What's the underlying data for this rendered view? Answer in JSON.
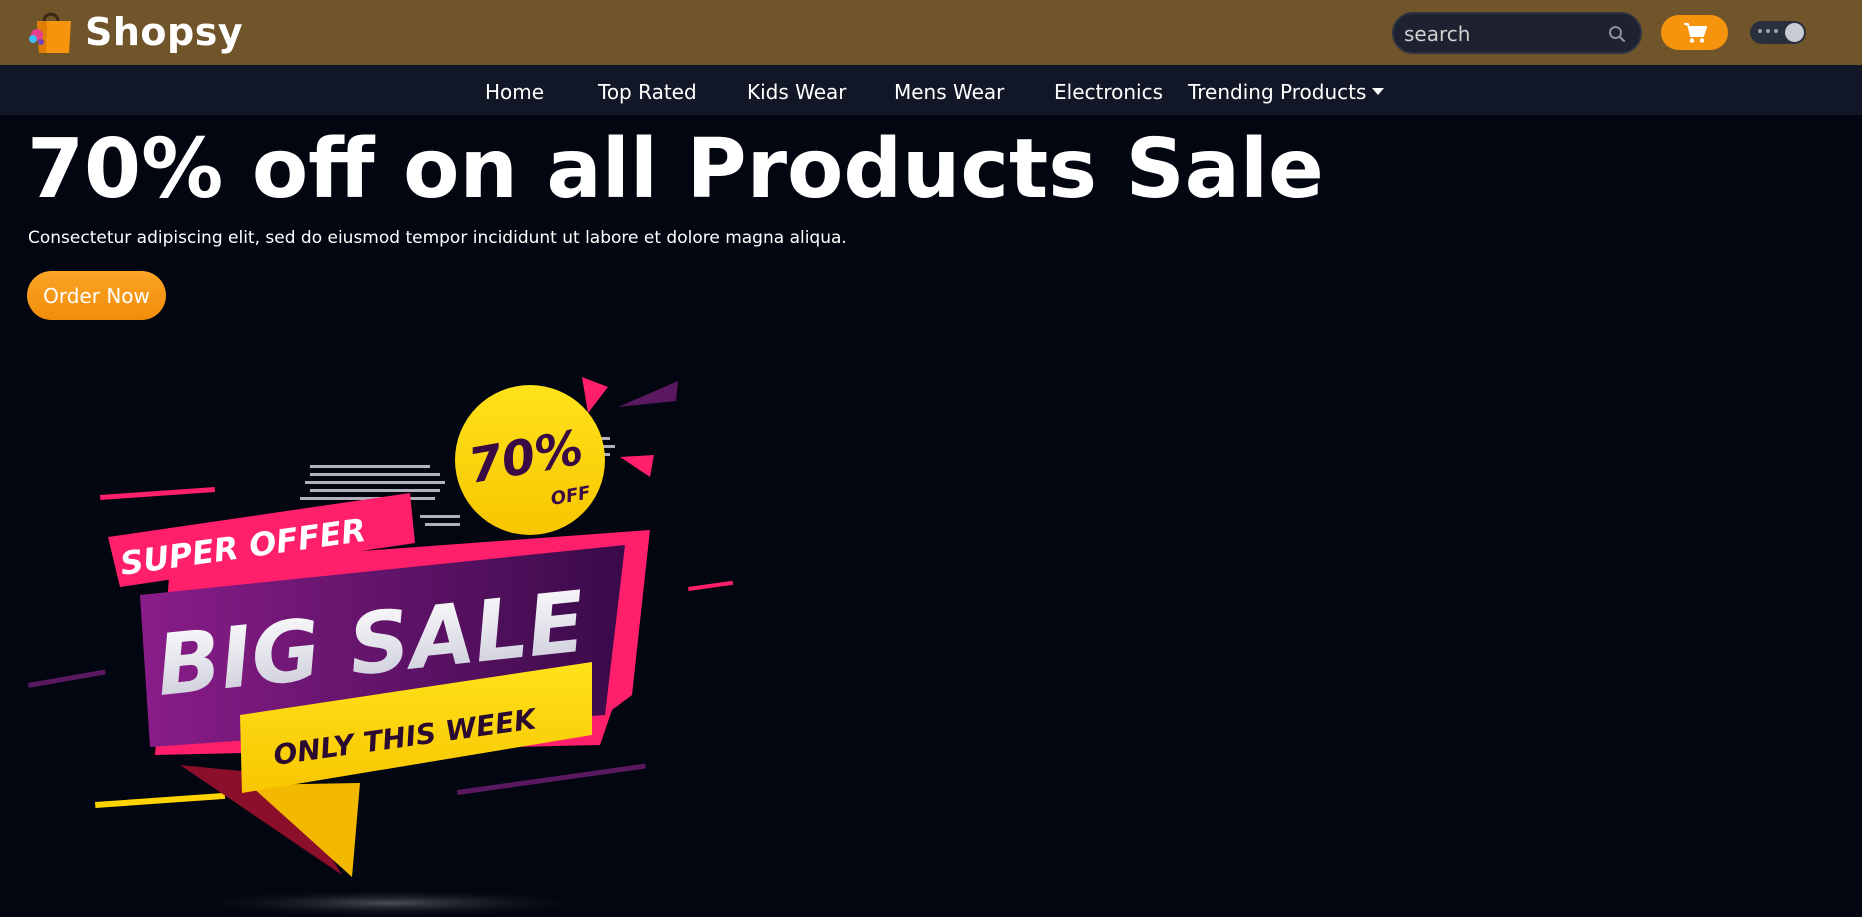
{
  "header": {
    "brand": "Shopsy",
    "logo_icon": "shopping-bag-icon",
    "search": {
      "placeholder": "search",
      "icon": "search-icon"
    },
    "cart_icon": "cart-icon",
    "theme_toggle": "dark-mode-toggle",
    "colors": {
      "header_bg": "#70552a",
      "accent": "#f7940d",
      "nav_bg": "#111726",
      "page_bg": "#020610"
    }
  },
  "nav": {
    "items": [
      {
        "label": "Home"
      },
      {
        "label": "Top Rated"
      },
      {
        "label": "Kids Wear"
      },
      {
        "label": "Mens Wear"
      },
      {
        "label": "Electronics"
      },
      {
        "label": "Trending Products",
        "icon": "caret-down-icon"
      }
    ]
  },
  "hero": {
    "title": "70% off on all Products Sale",
    "subtitle": "Consectetur adipiscing elit, sed do eiusmod tempor incididunt ut labore et dolore magna aliqua.",
    "cta_label": "Order Now",
    "banner": {
      "badge_percent": "70%",
      "badge_off": "OFF",
      "ribbon_top": "SUPER OFFER",
      "main_text": "BIG SALE",
      "ribbon_bottom": "ONLY THIS WEEK"
    }
  }
}
